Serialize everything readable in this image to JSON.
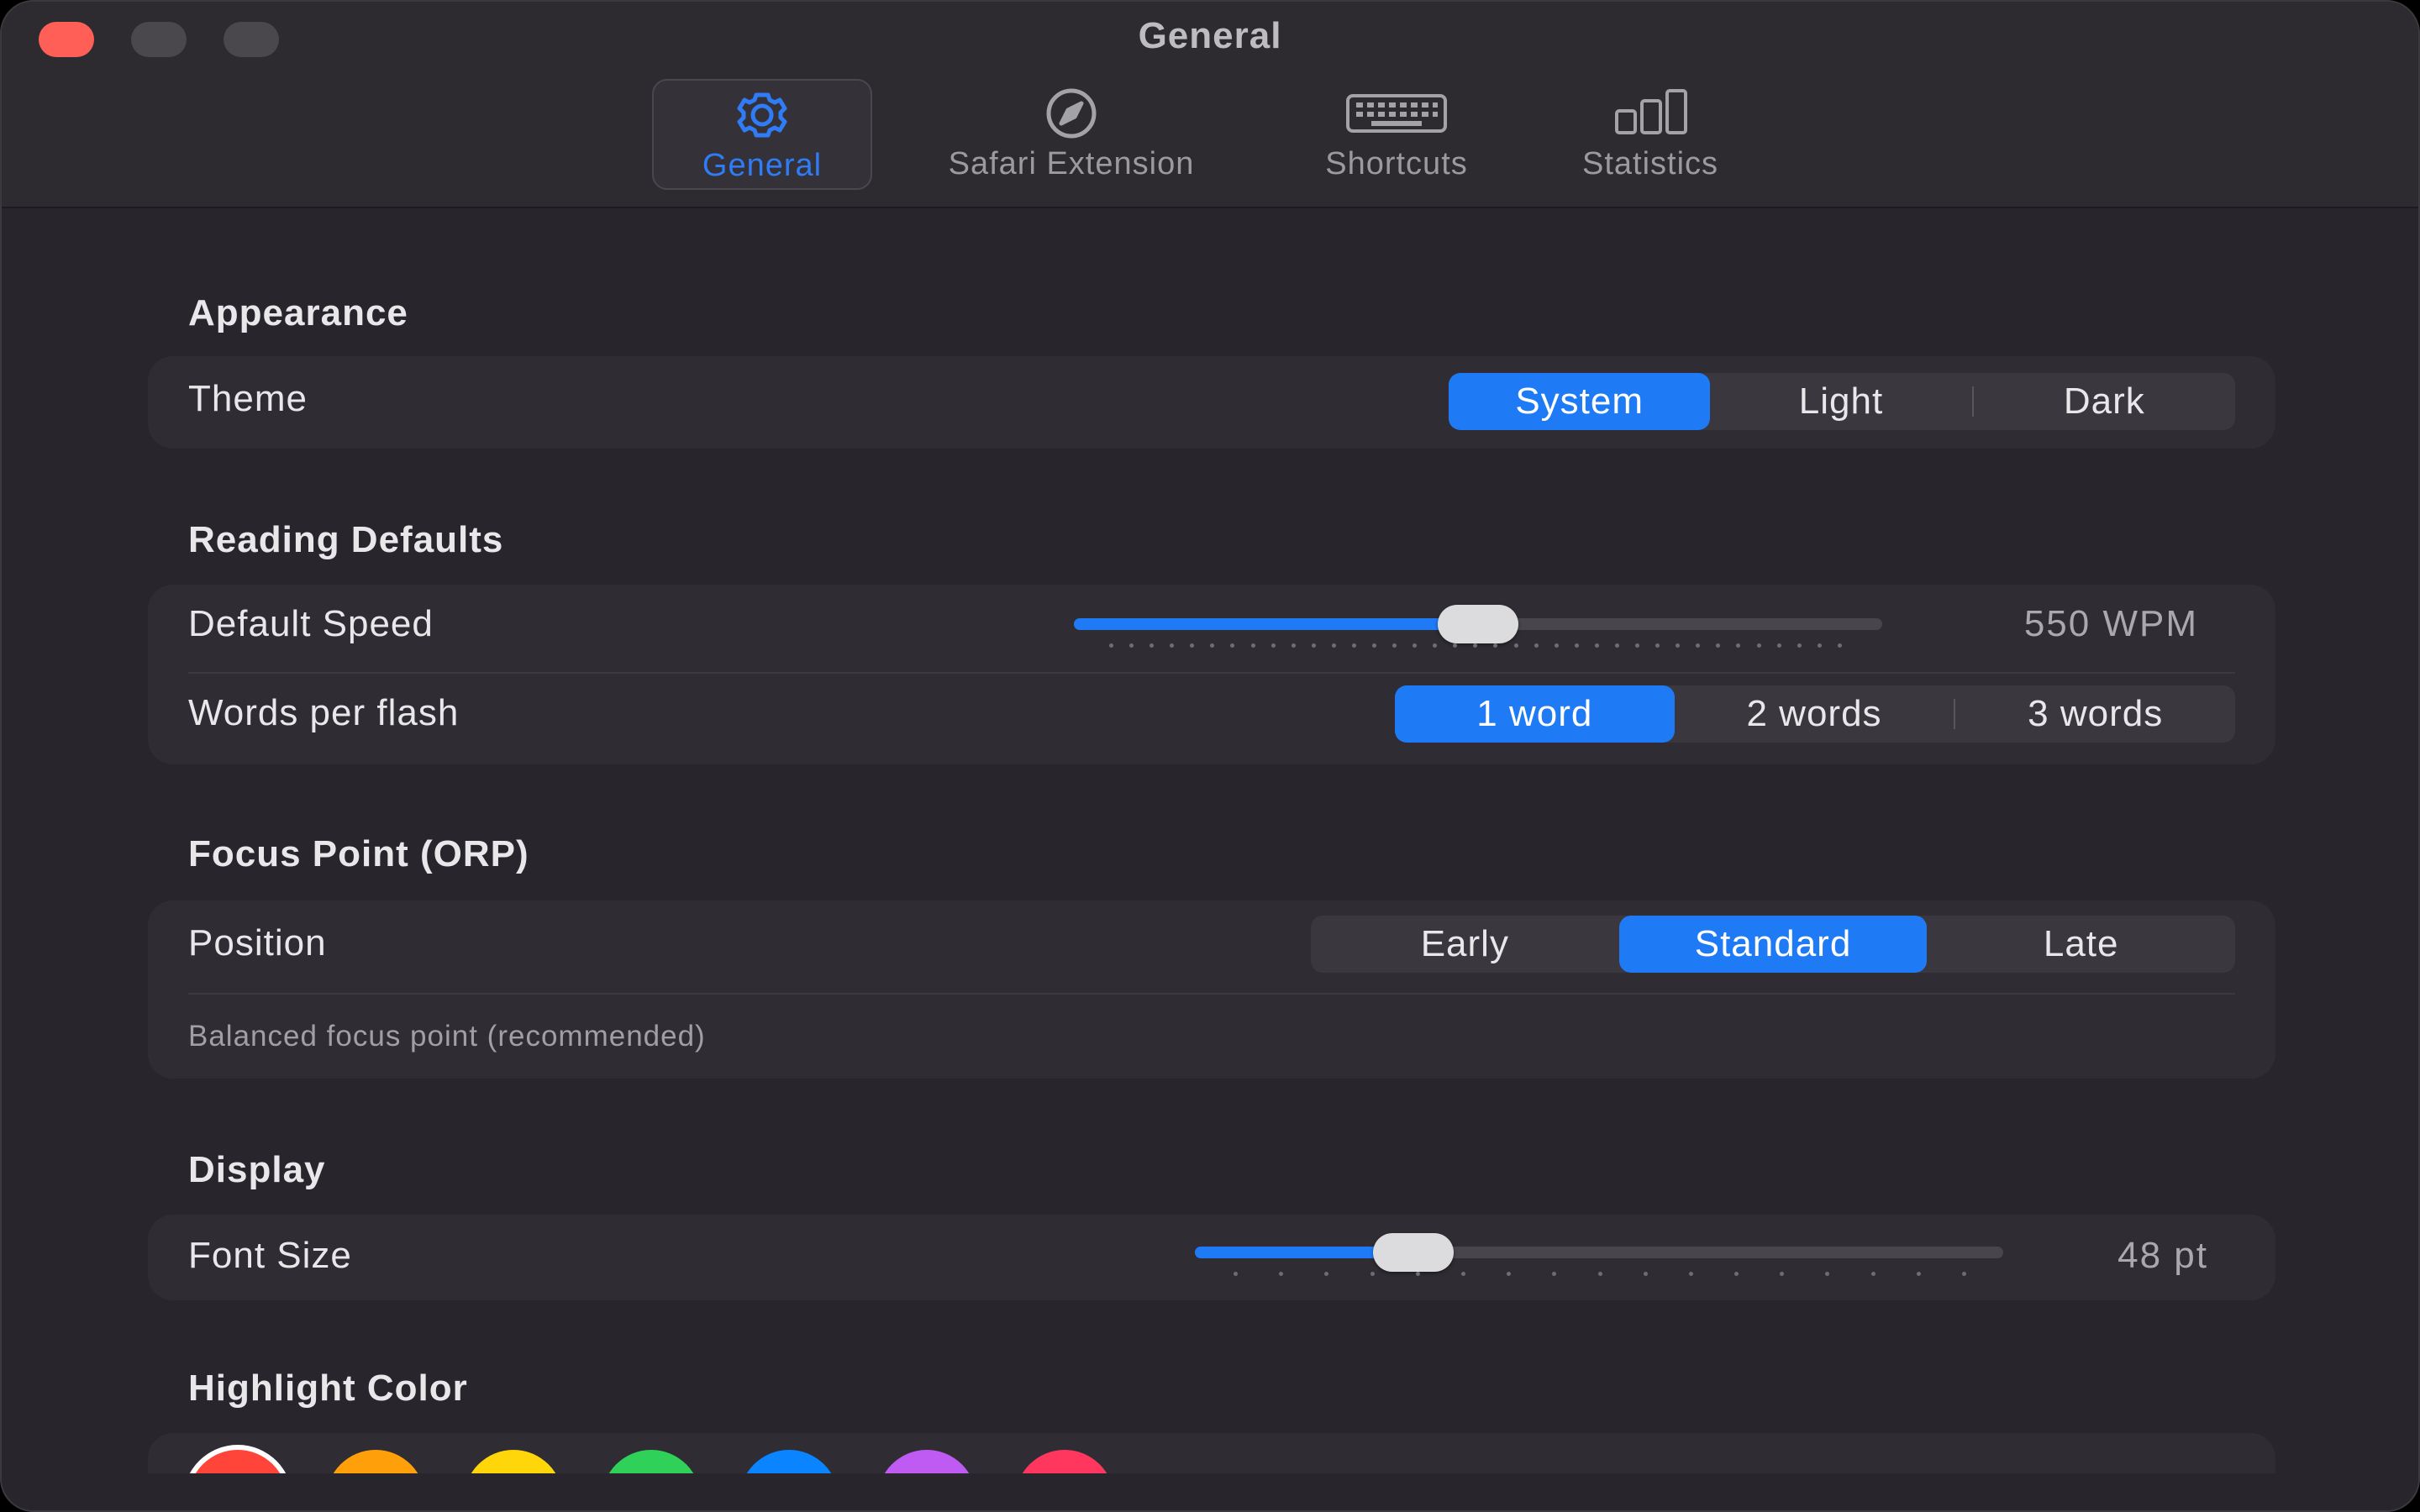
{
  "window": {
    "title": "General"
  },
  "toolbar": {
    "tabs": [
      {
        "label": "General",
        "icon": "gear-icon",
        "active": true
      },
      {
        "label": "Safari Extension",
        "icon": "compass-icon",
        "active": false
      },
      {
        "label": "Shortcuts",
        "icon": "keyboard-icon",
        "active": false
      },
      {
        "label": "Statistics",
        "icon": "bar-chart-icon",
        "active": false
      }
    ]
  },
  "appearance": {
    "title": "Appearance",
    "theme": {
      "label": "Theme",
      "options": [
        "System",
        "Light",
        "Dark"
      ],
      "selected": "System"
    }
  },
  "reading": {
    "title": "Reading Defaults",
    "speed": {
      "label": "Default Speed",
      "value_text": "550 WPM",
      "fraction": 0.5
    },
    "words": {
      "label": "Words per flash",
      "options": [
        "1 word",
        "2 words",
        "3 words"
      ],
      "selected": "1 word"
    }
  },
  "focus": {
    "title": "Focus Point (ORP)",
    "position": {
      "label": "Position",
      "options": [
        "Early",
        "Standard",
        "Late"
      ],
      "selected": "Standard"
    },
    "description": "Balanced focus point (recommended)"
  },
  "display": {
    "title": "Display",
    "font_size": {
      "label": "Font Size",
      "value_text": "48 pt",
      "fraction": 0.27
    }
  },
  "highlight": {
    "title": "Highlight Color",
    "colors": [
      "#ff453a",
      "#ff9f0a",
      "#ffd60a",
      "#30d158",
      "#0a84ff",
      "#bf5af2",
      "#ff375f"
    ],
    "selected": "#ff453a"
  },
  "colors": {
    "accent": "#1f7af5"
  }
}
